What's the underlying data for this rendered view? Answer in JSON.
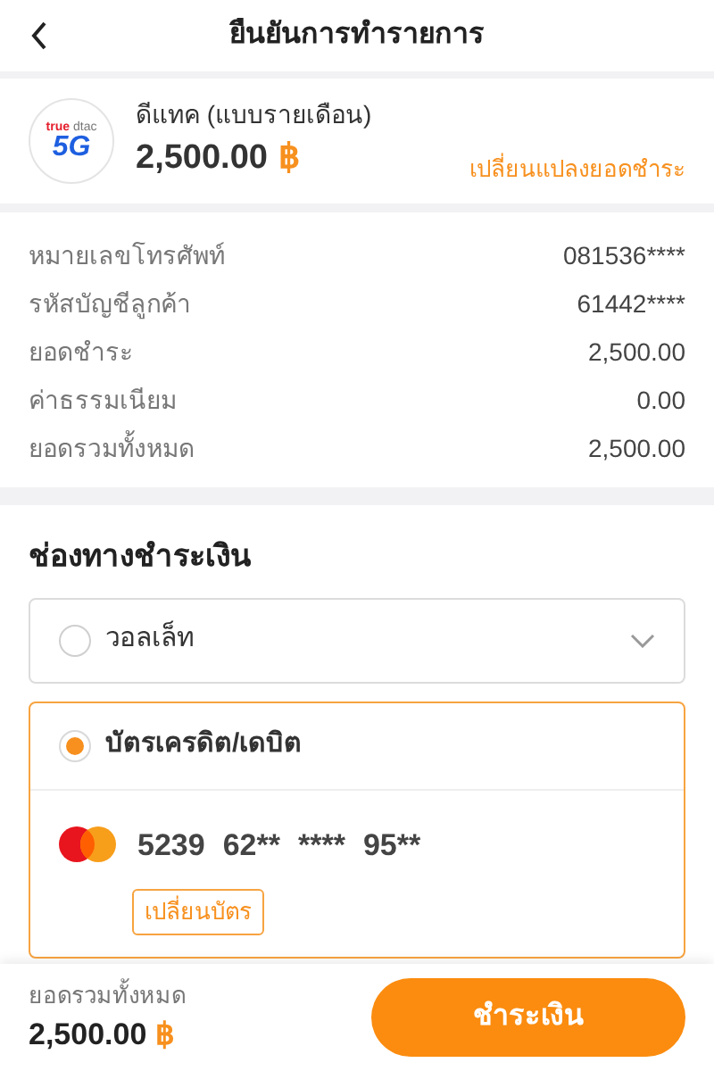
{
  "header": {
    "title": "ยืนยันการทำรายการ"
  },
  "product": {
    "logo": {
      "brand_left": "true",
      "brand_right": "dtac",
      "badge": "5G"
    },
    "name": "ดีแทค (แบบรายเดือน)",
    "amount": "2,500.00",
    "currency": "฿",
    "change_link": "เปลี่ยนแปลงยอดชำระ"
  },
  "details": [
    {
      "label": "หมายเลขโทรศัพท์",
      "value": "081536****"
    },
    {
      "label": "รหัสบัญชีลูกค้า",
      "value": "61442****"
    },
    {
      "label": "ยอดชำระ",
      "value": "2,500.00"
    },
    {
      "label": "ค่าธรรมเนียม",
      "value": "0.00"
    },
    {
      "label": "ยอดรวมทั้งหมด",
      "value": "2,500.00"
    }
  ],
  "payment": {
    "title": "ช่องทางชำระเงิน",
    "methods": [
      {
        "kind": "wallet",
        "label": "วอลเล็ท",
        "selected": false,
        "expanded": false
      },
      {
        "kind": "card",
        "label": "บัตรเครดิต/เดบิต",
        "selected": true,
        "expanded": true,
        "card_number": [
          "5239",
          "62**",
          "****",
          "95**"
        ],
        "change_button": "เปลี่ยนบัตร"
      }
    ]
  },
  "footer": {
    "total_label": "ยอดรวมทั้งหมด",
    "total": "2,500.00",
    "currency": "฿",
    "pay_button": "ชำระเงิน"
  }
}
